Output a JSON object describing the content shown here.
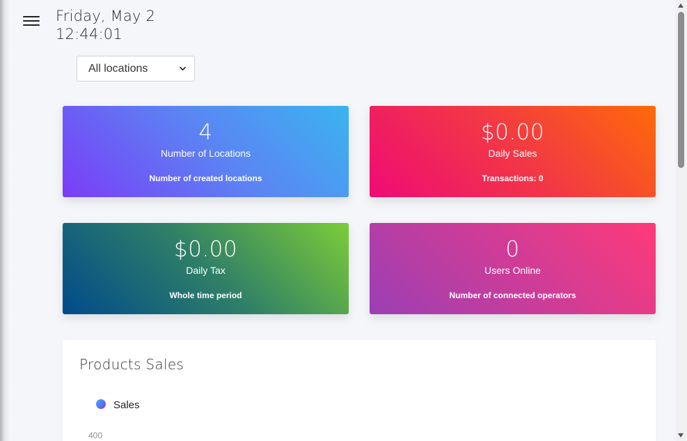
{
  "header": {
    "menu_icon": "hamburger-menu-icon",
    "date": "Friday, May 2",
    "time": "12:44:01"
  },
  "location_filter": {
    "selected": "All locations",
    "icon": "chevron-down-icon"
  },
  "cards": {
    "locations": {
      "value": "4",
      "label": "Number of Locations",
      "sub": "Number of created locations"
    },
    "sales": {
      "value": "$0.00",
      "label": "Daily Sales",
      "sub": "Transactions: 0"
    },
    "tax": {
      "value": "$0.00",
      "label": "Daily Tax",
      "sub": "Whole time period"
    },
    "users": {
      "value": "0",
      "label": "Users Online",
      "sub": "Number of connected operators"
    }
  },
  "products_sales": {
    "title": "Products Sales",
    "legend_label": "Sales",
    "y_tick_top": "400"
  },
  "colors": {
    "background": "#f4f6fa",
    "card_locations": [
      "#7b3cf7",
      "#3ab4f0"
    ],
    "card_sales": [
      "#ef0b76",
      "#fd6a08"
    ],
    "card_tax": [
      "#004a8b",
      "#7ccc38"
    ],
    "card_users": [
      "#9b3fb4",
      "#ff3a78"
    ]
  }
}
